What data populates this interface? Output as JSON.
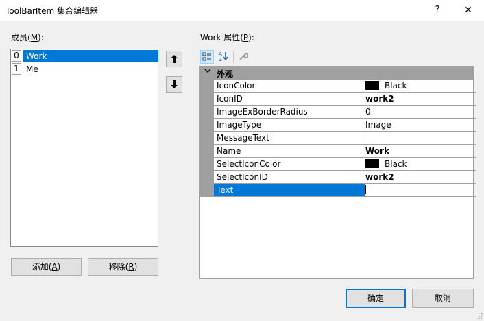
{
  "window": {
    "title": "ToolBarItem 集合编辑器",
    "help": "?",
    "close": "✕"
  },
  "members": {
    "label": "成员(M):",
    "label_prefix": "成员(",
    "label_key": "M",
    "label_suffix": "):",
    "items": [
      {
        "index": "0",
        "name": "Work",
        "selected": true
      },
      {
        "index": "1",
        "name": "Me",
        "selected": false
      }
    ],
    "move_up": "🡅",
    "move_down": "🡇"
  },
  "buttons": {
    "add_prefix": "添加(",
    "add_key": "A",
    "add_suffix": ")",
    "remove_prefix": "移除(",
    "remove_key": "R",
    "remove_suffix": ")",
    "ok": "确定",
    "cancel": "取消"
  },
  "properties": {
    "label_prefix": "Work 属性(",
    "label_key": "P",
    "label_suffix": "):",
    "category": "外观",
    "rows": [
      {
        "name": "IconColor",
        "value": "Black",
        "swatch": "#000000",
        "bold": false
      },
      {
        "name": "IconID",
        "value": "work2",
        "bold": true
      },
      {
        "name": "ImageExBorderRadius",
        "value": "0",
        "bold": false
      },
      {
        "name": "ImageType",
        "value": "Image",
        "bold": false
      },
      {
        "name": "MessageText",
        "value": "",
        "bold": false
      },
      {
        "name": "Name",
        "value": "Work",
        "bold": true
      },
      {
        "name": "SelectIconColor",
        "value": "Black",
        "swatch": "#000000",
        "bold": false
      },
      {
        "name": "SelectIconID",
        "value": "work2",
        "bold": true
      },
      {
        "name": "Text",
        "value": "",
        "bold": false,
        "selected": true
      }
    ]
  },
  "colors": {
    "selection": "#0078d7",
    "grid_line": "#a0a0a0",
    "background": "#f0f0f0"
  }
}
